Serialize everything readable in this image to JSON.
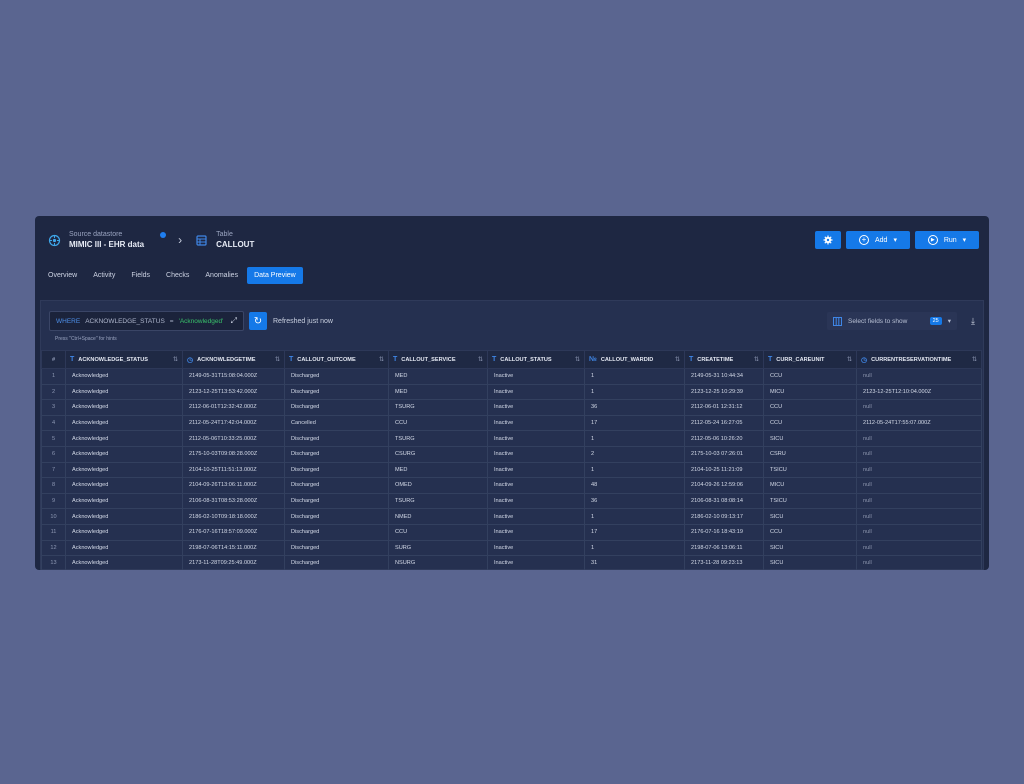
{
  "header": {
    "source_label": "Source datastore",
    "source_name": "MIMIC III - EHR data",
    "table_label": "Table",
    "table_name": "CALLOUT"
  },
  "actions": {
    "add": "Add",
    "run": "Run"
  },
  "tabs": [
    "Overview",
    "Activity",
    "Fields",
    "Checks",
    "Anomalies",
    "Data Preview"
  ],
  "active_tab": "Data Preview",
  "filter": {
    "keyword": "WHERE",
    "field": "ACKNOWLEDGE_STATUS",
    "operator": "=",
    "value": "'Acknowledged'",
    "hint": "Press \"Ctrl+Space\" for hints"
  },
  "refresh_text": "Refreshed just now",
  "field_selector": {
    "label": "Select fields to show",
    "count": "25"
  },
  "columns": [
    {
      "name": "#",
      "type": ""
    },
    {
      "name": "ACKNOWLEDGE_STATUS",
      "type": "T"
    },
    {
      "name": "ACKNOWLEDGETIME",
      "type": "clock"
    },
    {
      "name": "CALLOUT_OUTCOME",
      "type": "T"
    },
    {
      "name": "CALLOUT_SERVICE",
      "type": "T"
    },
    {
      "name": "CALLOUT_STATUS",
      "type": "T"
    },
    {
      "name": "CALLOUT_WARDID",
      "type": "num"
    },
    {
      "name": "CREATETIME",
      "type": "T"
    },
    {
      "name": "CURR_CAREUNIT",
      "type": "T"
    },
    {
      "name": "CURRENTRESERVATIONTIME",
      "type": "clock"
    }
  ],
  "rows": [
    [
      "1",
      "Acknowledged",
      "2149-05-31T15:08:04.000Z",
      "Discharged",
      "MED",
      "Inactive",
      "1",
      "2149-05-31 10:44:34",
      "CCU",
      "null"
    ],
    [
      "2",
      "Acknowledged",
      "2123-12-25T13:53:42.000Z",
      "Discharged",
      "MED",
      "Inactive",
      "1",
      "2123-12-25 10:29:39",
      "MICU",
      "2123-12-25T12:10:04.000Z"
    ],
    [
      "3",
      "Acknowledged",
      "2112-06-01T12:32:42.000Z",
      "Discharged",
      "TSURG",
      "Inactive",
      "36",
      "2112-06-01 12:31:12",
      "CCU",
      "null"
    ],
    [
      "4",
      "Acknowledged",
      "2112-05-24T17:42:04.000Z",
      "Cancelled",
      "CCU",
      "Inactive",
      "17",
      "2112-05-24 16:27:05",
      "CCU",
      "2112-05-24T17:55:07.000Z"
    ],
    [
      "5",
      "Acknowledged",
      "2112-05-06T10:33:25.000Z",
      "Discharged",
      "TSURG",
      "Inactive",
      "1",
      "2112-05-06 10:26:20",
      "SICU",
      "null"
    ],
    [
      "6",
      "Acknowledged",
      "2175-10-03T09:08:28.000Z",
      "Discharged",
      "CSURG",
      "Inactive",
      "2",
      "2175-10-03 07:26:01",
      "CSRU",
      "null"
    ],
    [
      "7",
      "Acknowledged",
      "2104-10-25T11:51:13.000Z",
      "Discharged",
      "MED",
      "Inactive",
      "1",
      "2104-10-25 11:21:09",
      "TSICU",
      "null"
    ],
    [
      "8",
      "Acknowledged",
      "2104-09-26T13:06:11.000Z",
      "Discharged",
      "OMED",
      "Inactive",
      "48",
      "2104-09-26 12:59:06",
      "MICU",
      "null"
    ],
    [
      "9",
      "Acknowledged",
      "2106-08-31T08:53:28.000Z",
      "Discharged",
      "TSURG",
      "Inactive",
      "36",
      "2106-08-31 08:08:14",
      "TSICU",
      "null"
    ],
    [
      "10",
      "Acknowledged",
      "2186-02-10T09:18:18.000Z",
      "Discharged",
      "NMED",
      "Inactive",
      "1",
      "2186-02-10 09:13:17",
      "SICU",
      "null"
    ],
    [
      "11",
      "Acknowledged",
      "2176-07-16T18:57:09.000Z",
      "Discharged",
      "CCU",
      "Inactive",
      "17",
      "2176-07-16 18:43:19",
      "CCU",
      "null"
    ],
    [
      "12",
      "Acknowledged",
      "2198-07-06T14:15:11.000Z",
      "Discharged",
      "SURG",
      "Inactive",
      "1",
      "2198-07-06 13:06:11",
      "SICU",
      "null"
    ],
    [
      "13",
      "Acknowledged",
      "2173-11-28T09:25:49.000Z",
      "Discharged",
      "NSURG",
      "Inactive",
      "31",
      "2173-11-28 09:23:13",
      "SICU",
      "null"
    ]
  ],
  "colors": {
    "accent": "#1579e8",
    "window_bg": "#1e2742",
    "page_bg": "#5a6590"
  }
}
